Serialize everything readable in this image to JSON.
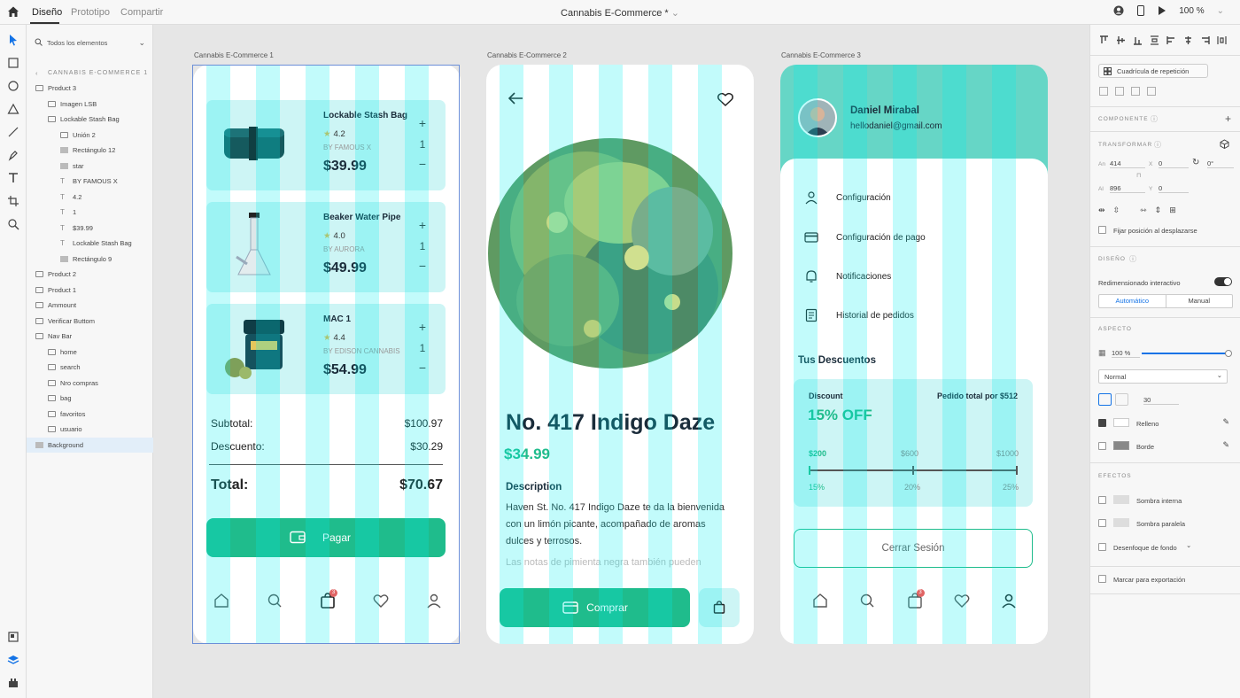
{
  "topbar": {
    "tabs": [
      "Diseño",
      "Prototipo",
      "Compartir"
    ],
    "document_title": "Cannabis E-Commerce *",
    "zoom": "100 %"
  },
  "layers": {
    "search_placeholder": "Todos los elementos",
    "breadcrumb": "CANNABIS E-COMMERCE 1",
    "items": [
      {
        "label": "Product 3",
        "depth": 0,
        "kind": "folder"
      },
      {
        "label": "Imagen LSB",
        "depth": 1,
        "kind": "image"
      },
      {
        "label": "Lockable Stash Bag",
        "depth": 1,
        "kind": "folder"
      },
      {
        "label": "Unión 2",
        "depth": 2,
        "kind": "union"
      },
      {
        "label": "Rectángulo 12",
        "depth": 2,
        "kind": "rect"
      },
      {
        "label": "star",
        "depth": 2,
        "kind": "rect"
      },
      {
        "label": "BY FAMOUS X",
        "depth": 2,
        "kind": "text"
      },
      {
        "label": "4.2",
        "depth": 2,
        "kind": "text"
      },
      {
        "label": "1",
        "depth": 2,
        "kind": "text"
      },
      {
        "label": "$39.99",
        "depth": 2,
        "kind": "text"
      },
      {
        "label": "Lockable Stash Bag",
        "depth": 2,
        "kind": "text"
      },
      {
        "label": "Rectángulo 9",
        "depth": 2,
        "kind": "rect"
      },
      {
        "label": "Product 2",
        "depth": 0,
        "kind": "folder"
      },
      {
        "label": "Product 1",
        "depth": 0,
        "kind": "folder"
      },
      {
        "label": "Ammount",
        "depth": 0,
        "kind": "folder"
      },
      {
        "label": "Verificar Buttom",
        "depth": 0,
        "kind": "folder"
      },
      {
        "label": "Nav Bar",
        "depth": 0,
        "kind": "folder"
      },
      {
        "label": "home",
        "depth": 1,
        "kind": "folder"
      },
      {
        "label": "search",
        "depth": 1,
        "kind": "folder"
      },
      {
        "label": "Nro compras",
        "depth": 1,
        "kind": "folder"
      },
      {
        "label": "bag",
        "depth": 1,
        "kind": "folder"
      },
      {
        "label": "favoritos",
        "depth": 1,
        "kind": "folder"
      },
      {
        "label": "usuario",
        "depth": 1,
        "kind": "folder"
      },
      {
        "label": "Background",
        "depth": 0,
        "kind": "rect",
        "selected": true
      }
    ]
  },
  "artboards": {
    "labels": [
      "Cannabis E-Commerce 1",
      "Cannabis E-Commerce 2",
      "Cannabis E-Commerce 3"
    ],
    "cart": {
      "products": [
        {
          "name": "Lockable Stash Bag",
          "rating": "4.2",
          "brand": "BY FAMOUS X",
          "price": "$39.99",
          "qty": "1"
        },
        {
          "name": "Beaker Water Pipe",
          "rating": "4.0",
          "brand": "BY AURORA",
          "price": "$49.99",
          "qty": "1"
        },
        {
          "name": "MAC 1",
          "rating": "4.4",
          "brand": "BY EDISON CANNABIS",
          "price": "$54.99",
          "qty": "1"
        }
      ],
      "plus": "+",
      "minus": "−",
      "subtotal_label": "Subtotal:",
      "subtotal_value": "$100.97",
      "discount_label": "Descuento:",
      "discount_value": "$30.29",
      "total_label": "Total:",
      "total_value": "$70.67",
      "pay_button": "Pagar",
      "bag_badge": "3"
    },
    "detail": {
      "title": "No. 417 Indigo Daze",
      "price": "$34.99",
      "description_heading": "Description",
      "description": "Haven St. No. 417 Indigo Daze te da la bienvenida con un limón picante, acompañado de aromas dulces y terrosos.",
      "description_fade": "Las notas de pimienta negra también pueden",
      "buy_button": "Comprar"
    },
    "profile": {
      "name": "Daniel Mirabal",
      "email": "hellodaniel@gmail.com",
      "menu": [
        "Configuración",
        "Configuración de pago",
        "Notificaciones",
        "Historial de pedidos"
      ],
      "discounts_heading": "Tus Descuentos",
      "discount_label": "Discount",
      "total_label": "Pedido total por $512",
      "discount_value": "15% OFF",
      "tiers": [
        {
          "amount": "$200",
          "percent": "15%"
        },
        {
          "amount": "$600",
          "percent": "20%"
        },
        {
          "amount": "$1000",
          "percent": "25%"
        }
      ],
      "progress": 0,
      "logout": "Cerrar Sesión",
      "bag_badge": "3"
    },
    "accent": "#1fbc8c",
    "grid_color": "#00f0f0"
  },
  "properties": {
    "repeat_grid": "Cuadrícula de repetición",
    "component": "COMPONENTE",
    "transform": "TRANSFORMAR",
    "w_label": "An",
    "w": "414",
    "h_label": "Al",
    "h": "896",
    "x_label": "X",
    "x": "0",
    "y_label": "Y",
    "y": "0",
    "rotation": "0°",
    "fix_scroll": "Fijar posición al desplazarse",
    "design": "DISEÑO",
    "resize": "Redimensionado interactivo",
    "auto": "Automático",
    "manual": "Manual",
    "appearance": "ASPECTO",
    "opacity": "100 %",
    "blend": "Normal",
    "radius": "30",
    "fill": "Relleno",
    "border": "Borde",
    "effects": "EFECTOS",
    "inner_shadow": "Sombra interna",
    "drop_shadow": "Sombra paralela",
    "bg_blur": "Desenfoque de fondo",
    "export": "Marcar para exportación"
  }
}
